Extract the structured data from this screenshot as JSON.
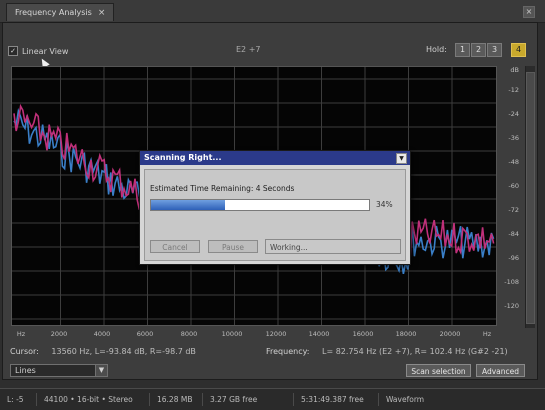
{
  "tab": {
    "title": "Frequency Analysis"
  },
  "toolbar": {
    "linear_view_label": "Linear View",
    "linear_view_checked": true,
    "note": "E2 +7",
    "hold_label": "Hold:",
    "hold_buttons": [
      "1",
      "2",
      "3",
      "4"
    ]
  },
  "plot": {
    "y_unit": "dB",
    "y_ticks": [
      "-12",
      "-24",
      "-36",
      "-48",
      "-60",
      "-72",
      "-84",
      "-96",
      "-108",
      "-120"
    ],
    "x_ticks": [
      "Hz",
      "2000",
      "4000",
      "6000",
      "8000",
      "10000",
      "12000",
      "14000",
      "16000",
      "18000",
      "20000",
      "Hz"
    ],
    "series_colors": {
      "left": "#c0307a",
      "right": "#3a7fc8"
    }
  },
  "info": {
    "cursor_label": "Cursor:",
    "cursor_value": "13560 Hz, L=-93.84 dB, R=-98.7 dB",
    "frequency_label": "Frequency:",
    "frequency_value": "L= 82.754 Hz (E2 +7), R= 102.4 Hz (G#2 -21)"
  },
  "controls": {
    "select_value": "Lines",
    "scan_selection": "Scan selection",
    "advanced": "Advanced"
  },
  "status": {
    "channel": "L: -5",
    "format": "44100 • 16-bit • Stereo",
    "size": "16.28 MB",
    "free": "3.27 GB free",
    "time_free": "5:31:49.387 free",
    "view": "Waveform"
  },
  "dialog": {
    "title": "Scanning Right...",
    "eta": "Estimated Time Remaining: 4 Seconds",
    "progress_percent": 34,
    "percent_text": "34%",
    "cancel": "Cancel",
    "pause": "Pause",
    "status": "Working..."
  }
}
